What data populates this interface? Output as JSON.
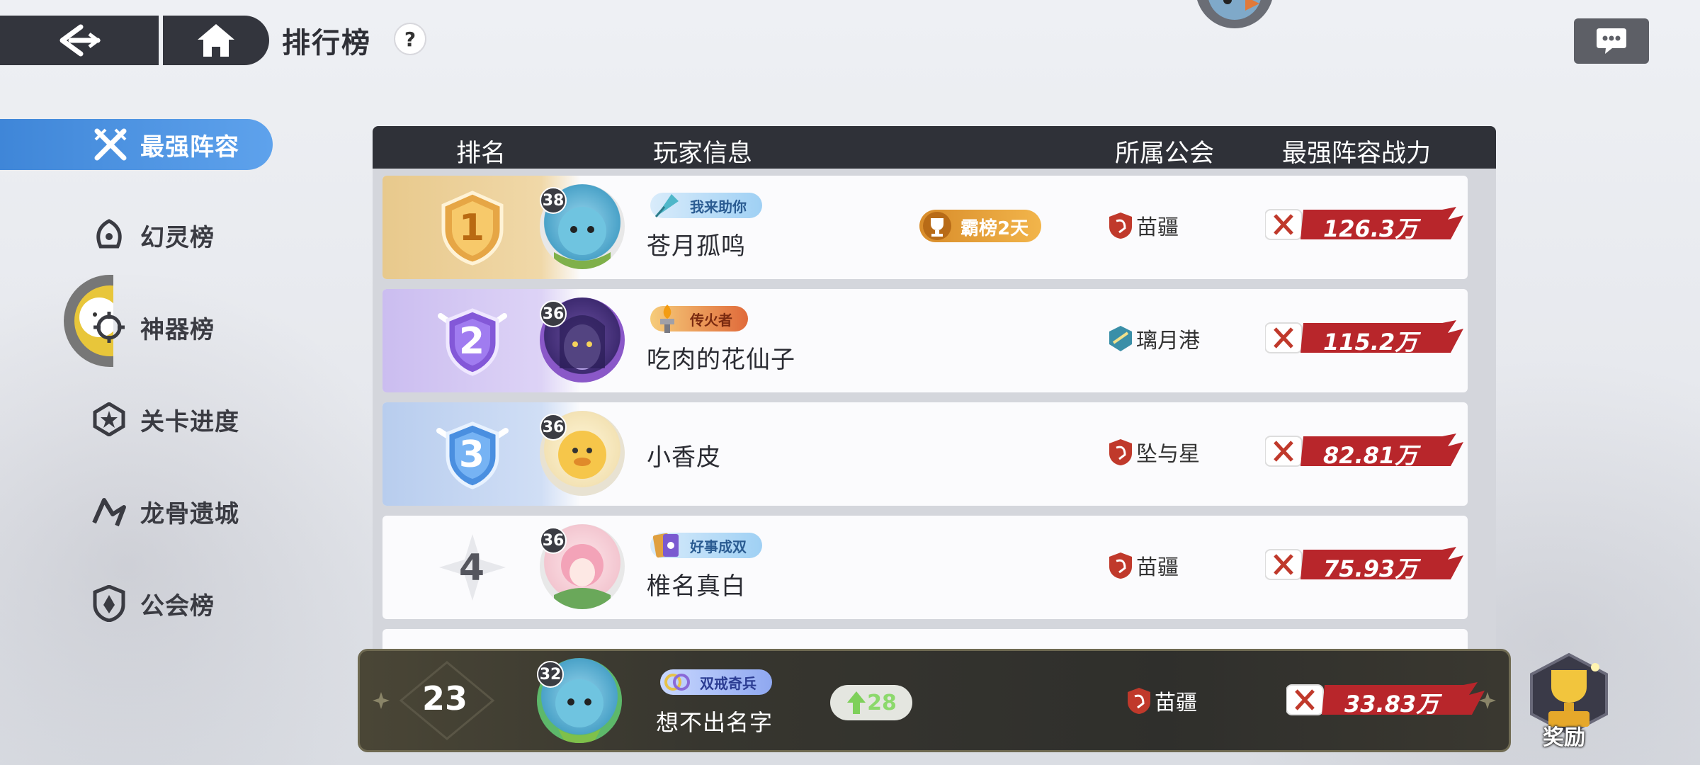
{
  "header": {
    "title": "排行榜",
    "help": "?"
  },
  "sidebar": {
    "items": [
      {
        "label": "最强阵容",
        "active": true,
        "icon": "crossed-swords-icon"
      },
      {
        "label": "幻灵榜",
        "active": false,
        "icon": "spirit-icon"
      },
      {
        "label": "神器榜",
        "active": false,
        "icon": "artifact-icon"
      },
      {
        "label": "关卡进度",
        "active": false,
        "icon": "star-badge-icon"
      },
      {
        "label": "龙骨遗城",
        "active": false,
        "icon": "dragon-icon"
      },
      {
        "label": "公会榜",
        "active": false,
        "icon": "shield-icon"
      }
    ]
  },
  "table": {
    "columns": [
      "排名",
      "玩家信息",
      "所属公会",
      "最强阵容战力"
    ],
    "rows": [
      {
        "rank": "1",
        "level": "38",
        "title": "我来助你",
        "name": "苍月孤鸣",
        "badge": "霸榜2天",
        "guild": "苗疆",
        "power": "126.3万"
      },
      {
        "rank": "2",
        "level": "36",
        "title": "传火者",
        "name": "吃肉的花仙子",
        "guild": "璃月港",
        "power": "115.2万"
      },
      {
        "rank": "3",
        "level": "36",
        "name": "小香皮",
        "guild": "坠与星",
        "power": "82.81万"
      },
      {
        "rank": "4",
        "level": "36",
        "title": "好事成双",
        "name": "椎名真白",
        "guild": "苗疆",
        "power": "75.93万"
      }
    ]
  },
  "my_rank": {
    "rank": "23",
    "level": "32",
    "title": "双戒奇兵",
    "name": "想不出名字",
    "rise": "28",
    "guild": "苗疆",
    "power": "33.83万"
  },
  "reward": {
    "label": "奖励"
  },
  "colors": {
    "accent_blue": "#4a90e2",
    "dark_bar": "#2f3138",
    "power_red": "#b8262b",
    "gold": "#e3b96b"
  }
}
